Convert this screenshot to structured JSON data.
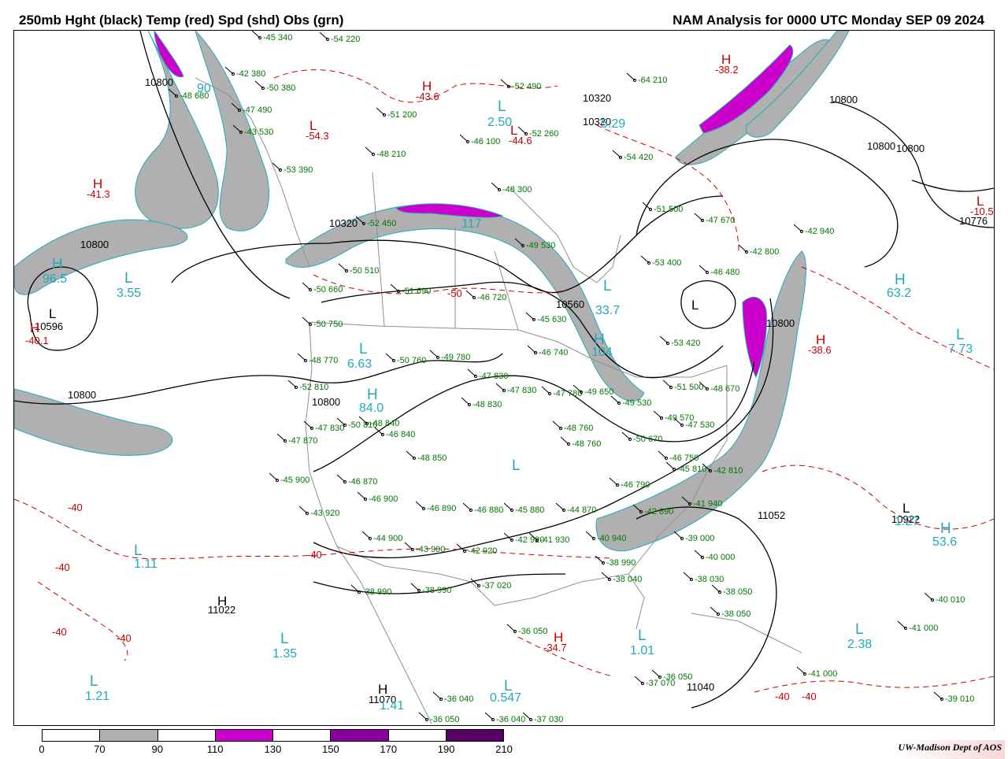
{
  "header": {
    "title_left": "250mb Hght (black) Temp (red) Spd (shd) Obs (grn)",
    "title_right": "NAM Analysis for 0000 UTC Monday  SEP 09 2024"
  },
  "colors": {
    "height_contour": "#000000",
    "temperature_contour": "#cc0000",
    "observations": "#007700",
    "isotach_labels": "#22aabb",
    "speed_70_90": "#b0b0b0",
    "speed_110_130": "#cc00cc",
    "speed_150_170": "#880099",
    "speed_190_210": "#550066",
    "land_border": "#808080"
  },
  "colorbar": {
    "ticks": [
      "0",
      "70",
      "90",
      "110",
      "130",
      "150",
      "170",
      "190",
      "210"
    ],
    "fills": [
      "#ffffff",
      "#b0b0b0",
      "#ffffff",
      "#cc00cc",
      "#ffffff",
      "#880099",
      "#ffffff",
      "#550066"
    ]
  },
  "credit": "UW-Madison   Dept of AOS",
  "height_labels": [
    "10800",
    "10800",
    "10320",
    "10320",
    "10800",
    "10800",
    "10800",
    "10596",
    "10800",
    "10800",
    "10320",
    "10560",
    "10800",
    "10776",
    "11052",
    "10922",
    "11022",
    "11040",
    "11070"
  ],
  "temp_labels": [
    "-41.3",
    "-43.6",
    "-54.3",
    "-44.6",
    "-38.2",
    "-40.1",
    "-38.6",
    "-10.5",
    "-40",
    "-40",
    "-40",
    "-40",
    "-40",
    "-34.7",
    "-40",
    "-40",
    "-50"
  ],
  "isotach_labels": [
    "96.5",
    "3.55",
    "2.50",
    "5.29",
    "117",
    "90",
    "63.2",
    "7.73",
    "6.63",
    "104",
    "33.7",
    "84.0",
    "1.11",
    "1.35",
    "1.01",
    "0.547",
    "1.21",
    "1.41",
    "2.38",
    "53.6",
    "1.27"
  ],
  "obs_labels": [
    "-45 340",
    "-42 380",
    "-48 680",
    "-50 380",
    "-47 490",
    "-43 530",
    "-54 220",
    "-52 490",
    "-51 200",
    "-48 210",
    "-53 390",
    "-46 100",
    "-52 260",
    "-54 420",
    "-64 210",
    "-48 300",
    "-52 450",
    "-49 530",
    "-51 500",
    "-47 670",
    "-42 940",
    "-42 800",
    "-53 400",
    "-50 510",
    "-50 660",
    "-51 690",
    "-46 720",
    "-45 630",
    "-46 480",
    "-50 750",
    "-48 770",
    "-50 760",
    "-49 780",
    "-46 740",
    "-47 830",
    "-47 830",
    "-48 830",
    "-47 780",
    "-49 650",
    "-53 420",
    "-49 530",
    "-51 500",
    "-48 670",
    "-52 810",
    "-47 830",
    "-47 870",
    "-50 810",
    "-48 840",
    "-46 840",
    "-48 850",
    "-46 870",
    "-48 760",
    "-48 760",
    "-50 670",
    "-46 790",
    "-49 570",
    "-47 530",
    "-46 750",
    "-45 810",
    "-42 810",
    "-45 900",
    "-43 920",
    "-46 900",
    "-46 890",
    "-46 880",
    "-45 880",
    "-44 870",
    "-42 890",
    "-41 940",
    "-44 900",
    "-43 900",
    "-42 920",
    "-42 920",
    "-41 930",
    "-40 940",
    "-39 000",
    "-40 000",
    "-38 990",
    "-38 040",
    "-38 030",
    "-38 050",
    "-38 050",
    "-38 990",
    "-38 990",
    "-37 020",
    "-36 050",
    "-40 010",
    "-41 000",
    "-41 000",
    "-39 010",
    "-37 070",
    "-36 050",
    "-36 040",
    "-36 050",
    "-36 040",
    "-37 030"
  ]
}
